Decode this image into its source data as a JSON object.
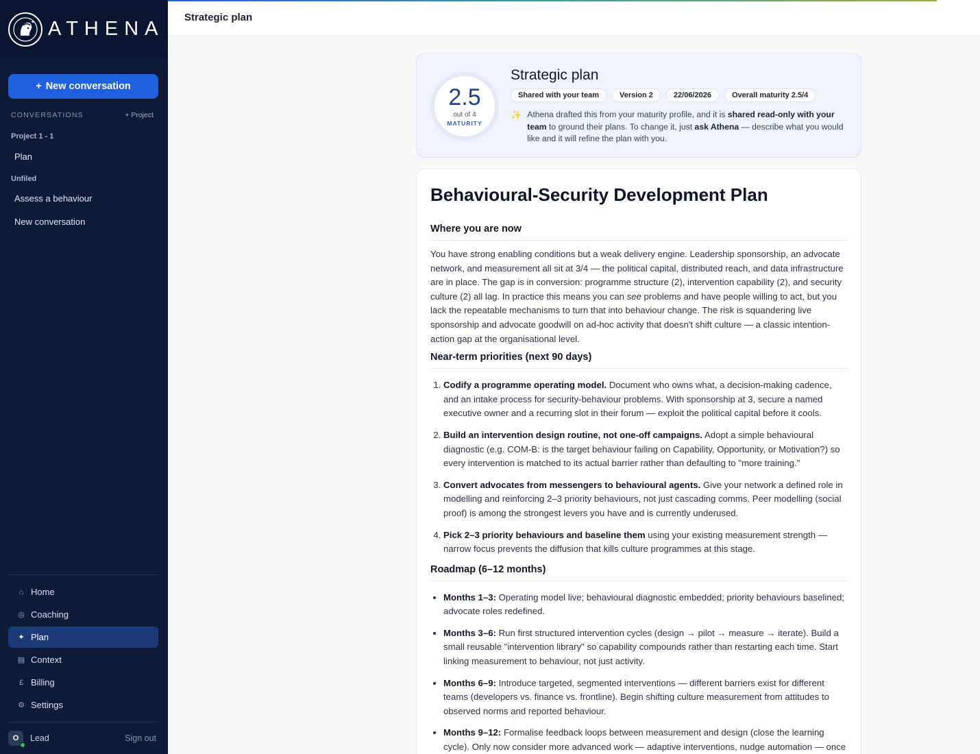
{
  "app": {
    "logo_text": "ATHENA"
  },
  "sidebar": {
    "new_conversation_label": "New conversation",
    "new_conversation_icon": "+",
    "section_title": "CONVERSATIONS",
    "add_project_label": "+ Project",
    "groups": [
      {
        "label": "Project 1 - 1",
        "items": [
          "Plan"
        ]
      },
      {
        "label": "Unfiled",
        "items": [
          "Assess a behaviour",
          "New conversation"
        ]
      }
    ],
    "nav": [
      {
        "label": "Home",
        "icon": "⌂",
        "active": false
      },
      {
        "label": "Coaching",
        "icon": "◎",
        "active": false
      },
      {
        "label": "Plan",
        "icon": "✦",
        "active": true
      },
      {
        "label": "Context",
        "icon": "▤",
        "active": false
      },
      {
        "label": "Billing",
        "icon": "£",
        "active": false
      },
      {
        "label": "Settings",
        "icon": "⚙",
        "active": false
      }
    ],
    "user": {
      "initial": "O",
      "name": "Lead",
      "sign_out": "Sign out"
    }
  },
  "topbar": {
    "title": "Strategic plan"
  },
  "header_card": {
    "score": "2.5",
    "score_of": "out of 4",
    "score_label": "MATURITY",
    "title": "Strategic plan",
    "chips": [
      "Shared with your team",
      "Version 2",
      "22/06/2026",
      "Overall maturity 2.5/4"
    ],
    "note_pre": "Athena drafted this from your maturity profile, and it is ",
    "note_bold1": "shared read-only with your team",
    "note_mid": " to ground their plans. To change it, just ",
    "note_bold2": "ask Athena",
    "note_post": " — describe what you would like and it will refine the plan with you."
  },
  "document": {
    "title": "Behavioural-Security Development Plan",
    "where_heading": "Where you are now",
    "where_p1": "You have strong enabling conditions but a weak delivery engine. Leadership sponsorship, an advocate network, and measurement all sit at 3/4 — the political capital, distributed reach, and data infrastructure are in place. The gap is in conversion: programme structure (2), intervention capability (2), and security culture (2) all lag. In practice this means you can ",
    "where_em": "see",
    "where_p2": " problems and have people willing to act, but you lack the repeatable mechanisms to turn that into behaviour change. The risk is squandering live sponsorship and advocate goodwill on ad-hoc activity that doesn't shift culture — a classic intention-action gap at the organisational level.",
    "near_heading": "Near-term priorities (next 90 days)",
    "priorities": [
      {
        "bold": "Codify a programme operating model.",
        "text": " Document who owns what, a decision-making cadence, and an intake process for security-behaviour problems. With sponsorship at 3, secure a named executive owner and a recurring slot in their forum — exploit the political capital before it cools."
      },
      {
        "bold": "Build an intervention design routine, not one-off campaigns.",
        "text": " Adopt a simple behavioural diagnostic (e.g. COM-B: is the target behaviour failing on Capability, Opportunity, or Motivation?) so every intervention is matched to its actual barrier rather than defaulting to \"more training.\""
      },
      {
        "bold": "Convert advocates from messengers to behavioural agents.",
        "text": " Give your network a defined role in modelling and reinforcing 2–3 priority behaviours, not just cascading comms. Peer modelling (social proof) is among the strongest levers you have and is currently underused."
      },
      {
        "bold": "Pick 2–3 priority behaviours and baseline them",
        "text": " using your existing measurement strength — narrow focus prevents the diffusion that kills culture programmes at this stage."
      }
    ],
    "roadmap_heading": "Roadmap (6–12 months)",
    "roadmap": [
      {
        "bold": "Months 1–3:",
        "text": " Operating model live; behavioural diagnostic embedded; priority behaviours baselined; advocate roles redefined."
      },
      {
        "bold": "Months 3–6:",
        "text": " Run first structured intervention cycles (design → pilot → measure → iterate). Build a small reusable \"intervention library\" so capability compounds rather than restarting each time. Start linking measurement to behaviour, not just activity."
      },
      {
        "bold": "Months 6–9:",
        "text": " Introduce targeted, segmented interventions — different barriers exist for different teams (developers vs. finance vs. frontline). Begin shifting culture measurement from attitudes to observed norms and reported behaviour."
      },
      {
        "bold": "Months 9–12:",
        "text": " Formalise feedback loops between measurement and design (close the learning cycle). Only now consider more advanced work — adaptive interventions, nudge automation — once"
      }
    ]
  }
}
